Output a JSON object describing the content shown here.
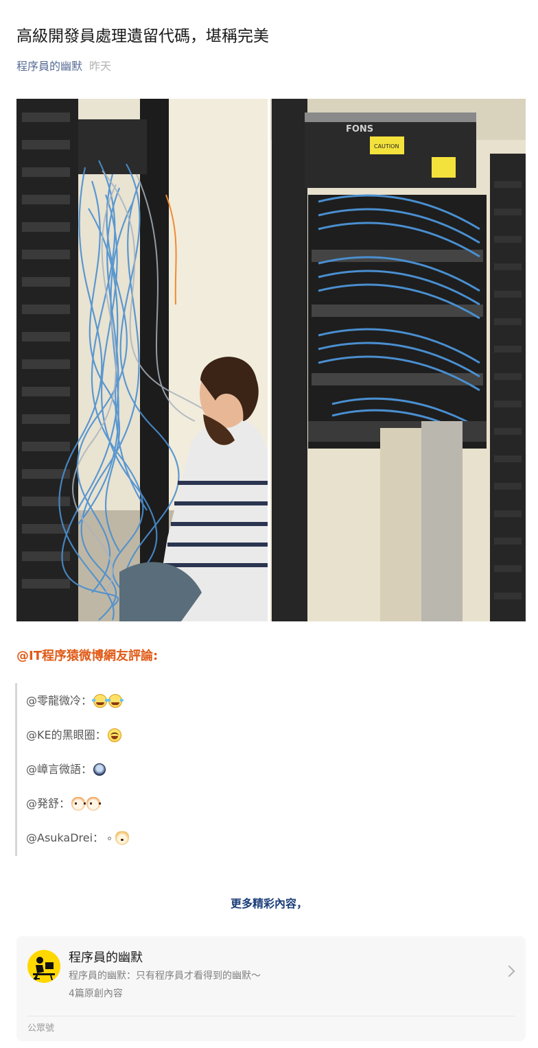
{
  "article": {
    "title": "高級開發員處理遺留代碼，堪稱完美",
    "account_name": "程序員的幽默",
    "date": "昨天"
  },
  "photo": {
    "rack_brand_text": "FONS",
    "caution_label": "CAUTION"
  },
  "comments": {
    "heading": "@IT程序猿微博網友評論:",
    "items": [
      {
        "user": "@零龍微冷：",
        "emojis": [
          "tear",
          "tear"
        ]
      },
      {
        "user": "@KE的黑眼圈：",
        "emojis": [
          "laugh"
        ]
      },
      {
        "user": "@嶂言微語：",
        "emojis": [
          "blue"
        ]
      },
      {
        "user": "@発舒：",
        "emojis": [
          "cat",
          "cat"
        ]
      },
      {
        "user": "@AsukaDrei：",
        "emojis": [
          "dot",
          "dog"
        ]
      }
    ]
  },
  "more_content": "更多精彩內容，",
  "account_card": {
    "name": "程序員的幽默",
    "description": "程序員的幽默：只有程序員才看得到的幽默～",
    "post_count": "4篇原創內容",
    "footer_label": "公眾號",
    "avatar_icon": "programmer-at-desk-icon"
  },
  "colors": {
    "accent_orange": "#e05a16",
    "link_blue": "#576b95",
    "more_blue": "#1b3d78",
    "cable_blue": "#4a8fd0"
  }
}
